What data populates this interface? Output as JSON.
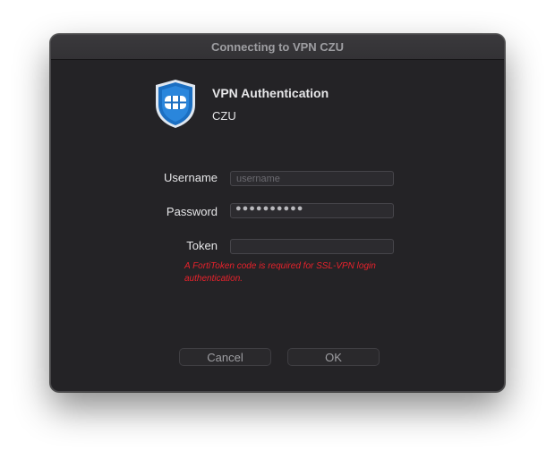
{
  "window": {
    "title": "Connecting to VPN CZU"
  },
  "header": {
    "logo_icon": "fortinet-shield-icon",
    "title": "VPN Authentication",
    "subtitle": "CZU"
  },
  "form": {
    "username": {
      "label": "Username",
      "value": "",
      "placeholder": "username"
    },
    "password": {
      "label": "Password",
      "masked_value": "●●●●●●●●●●"
    },
    "token": {
      "label": "Token",
      "value": ""
    },
    "error_message": "A FortiToken code is required for SSL-VPN login authentication."
  },
  "buttons": {
    "cancel_label": "Cancel",
    "ok_label": "OK"
  },
  "colors": {
    "window_bg": "#242326",
    "text": "#e6e6e8",
    "error": "#e8222b",
    "logo_blue": "#1b6fc2"
  }
}
